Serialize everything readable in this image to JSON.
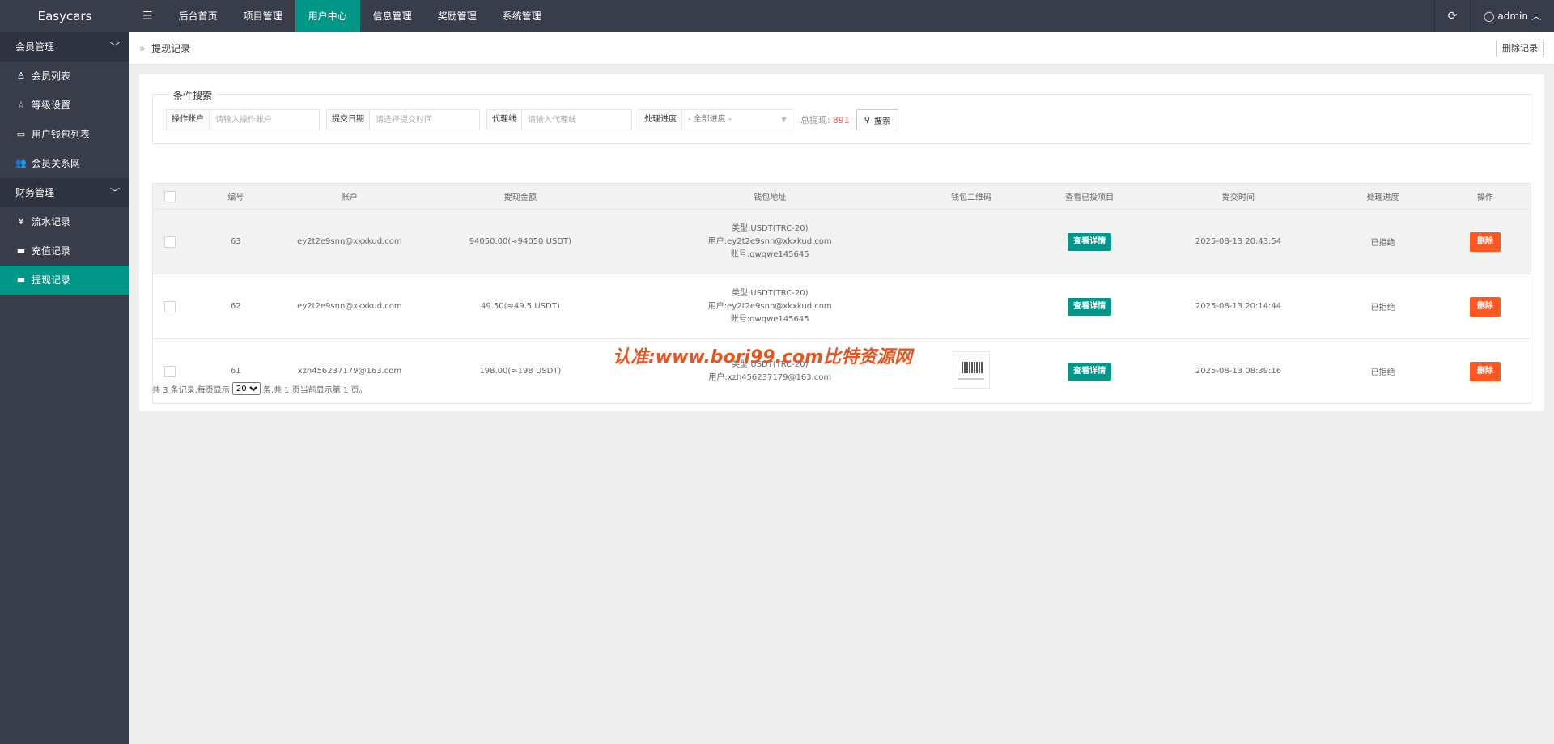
{
  "app": {
    "logo": "Easycars"
  },
  "topnav": {
    "toggle_icon": "☰",
    "items": [
      {
        "label": "后台首页"
      },
      {
        "label": "项目管理"
      },
      {
        "label": "用户中心"
      },
      {
        "label": "信息管理"
      },
      {
        "label": "奖励管理"
      },
      {
        "label": "系统管理"
      }
    ],
    "active_index": 2,
    "refresh_icon": "refresh-icon",
    "user": {
      "name": "admin"
    }
  },
  "sidebar": {
    "groups": [
      {
        "label": "会员管理",
        "items": [
          {
            "label": "会员列表",
            "icon": "user-icon"
          },
          {
            "label": "等级设置",
            "icon": "star-icon"
          },
          {
            "label": "用户钱包列表",
            "icon": "card-icon"
          },
          {
            "label": "会员关系网",
            "icon": "users-icon"
          }
        ]
      },
      {
        "label": "财务管理",
        "items": [
          {
            "label": "流水记录",
            "icon": "yen-icon"
          },
          {
            "label": "充值记录",
            "icon": "card-icon"
          },
          {
            "label": "提现记录",
            "icon": "card-icon"
          }
        ]
      }
    ],
    "active": "提现记录"
  },
  "breadcrumb": {
    "separator": "»",
    "current": "提现记录"
  },
  "header_actions": {
    "delete_records_label": "删除记录"
  },
  "search": {
    "legend": "条件搜索",
    "account_label": "操作账户",
    "account_placeholder": "请输入操作账户",
    "date_label": "提交日期",
    "date_placeholder": "请选择提交时间",
    "agent_label": "代理线",
    "agent_placeholder": "请输入代理线",
    "progress_label": "处理进度",
    "progress_selected": "- 全部进度 -",
    "total_label": "总提现:",
    "total_value": "891",
    "search_button": "搜索"
  },
  "table": {
    "headers": [
      "编号",
      "账户",
      "提现金额",
      "钱包地址",
      "钱包二维码",
      "查看已投项目",
      "提交时间",
      "处理进度",
      "操作"
    ],
    "rows": [
      {
        "id": "63",
        "account": "ey2t2e9snn@xkxkud.com",
        "amount": "94050.00(≈94050 USDT)",
        "addr_type": "类型:USDT(TRC-20)",
        "addr_user": "用户:ey2t2e9snn@xkxkud.com",
        "addr_no": "账号:qwqwe145645",
        "has_qr": false,
        "detail_btn": "查看详情",
        "time": "2025-08-13 20:43:54",
        "status": "已拒绝",
        "delete_btn": "删除"
      },
      {
        "id": "62",
        "account": "ey2t2e9snn@xkxkud.com",
        "amount": "49.50(≈49.5 USDT)",
        "addr_type": "类型:USDT(TRC-20)",
        "addr_user": "用户:ey2t2e9snn@xkxkud.com",
        "addr_no": "账号:qwqwe145645",
        "has_qr": false,
        "detail_btn": "查看详情",
        "time": "2025-08-13 20:14:44",
        "status": "已拒绝",
        "delete_btn": "删除"
      },
      {
        "id": "61",
        "account": "xzh456237179@163.com",
        "amount": "198.00(≈198 USDT)",
        "addr_type": "类型:USDT(TRC-20)",
        "addr_user": "用户:xzh456237179@163.com",
        "addr_no": "",
        "has_qr": true,
        "detail_btn": "查看详情",
        "time": "2025-08-13 08:39:16",
        "status": "已拒绝",
        "delete_btn": "删除"
      }
    ]
  },
  "pager": {
    "prefix": "共 3 条记录,每页显示",
    "page_size": "20",
    "suffix": "条,共 1 页当前显示第 1 页。"
  },
  "watermark": "认准:www.bori99.com比特资源网"
}
